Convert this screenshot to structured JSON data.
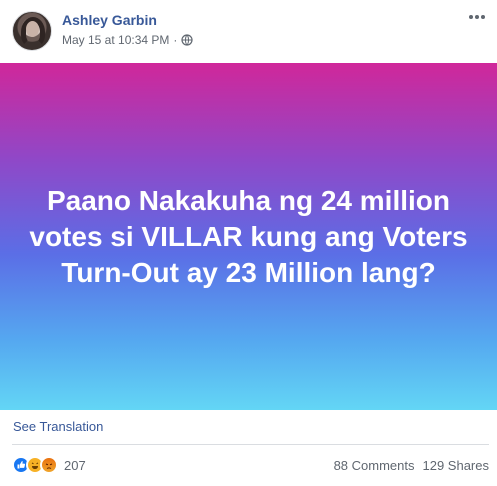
{
  "post": {
    "author": "Ashley Garbin",
    "timestamp": "May 15 at 10:34 PM",
    "separator": "·",
    "privacy_icon": "globe-icon",
    "banner_text": "Paano Nakakuha ng 24 million votes si VILLAR kung ang Voters Turn-Out ay 23 Million lang?",
    "banner_colors": [
      "#d0279a",
      "#8f48c8",
      "#5b6ee6",
      "#55a8f0",
      "#63d6f5"
    ],
    "see_translation": "See Translation",
    "reactions": {
      "icons": [
        "like-icon",
        "haha-icon",
        "angry-icon"
      ],
      "count": "207"
    },
    "comments": "88 Comments",
    "shares": "129 Shares"
  },
  "colors": {
    "link": "#385898",
    "secondary_text": "#606770"
  }
}
